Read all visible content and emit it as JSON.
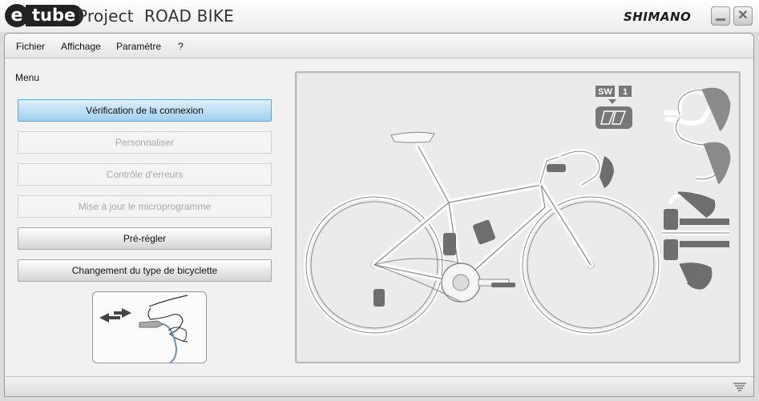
{
  "titlebar": {
    "logo_e": "e",
    "logo_tube": "tube",
    "title": "Project  ROAD BIKE",
    "brand": "SHIMANO"
  },
  "menubar": {
    "items": [
      "Fichier",
      "Affichage",
      "Paramètre",
      "?"
    ]
  },
  "sidebar": {
    "label": "Menu",
    "buttons": [
      {
        "label": "Vérification de la connexion",
        "state": "active"
      },
      {
        "label": "Personnaliser",
        "state": "disabled"
      },
      {
        "label": "Contrôle d'erreurs",
        "state": "disabled"
      },
      {
        "label": "Mise à jour le microprogramme",
        "state": "disabled"
      },
      {
        "label": "Pré-régler",
        "state": "normal"
      },
      {
        "label": "Changement du type de bicyclette",
        "state": "normal"
      }
    ]
  },
  "diagram": {
    "sw_label": "SW",
    "sw_number": "1"
  },
  "colors": {
    "active_button": "#9fd0ef",
    "line": "#ffffff",
    "component": "#6e6e6e"
  }
}
